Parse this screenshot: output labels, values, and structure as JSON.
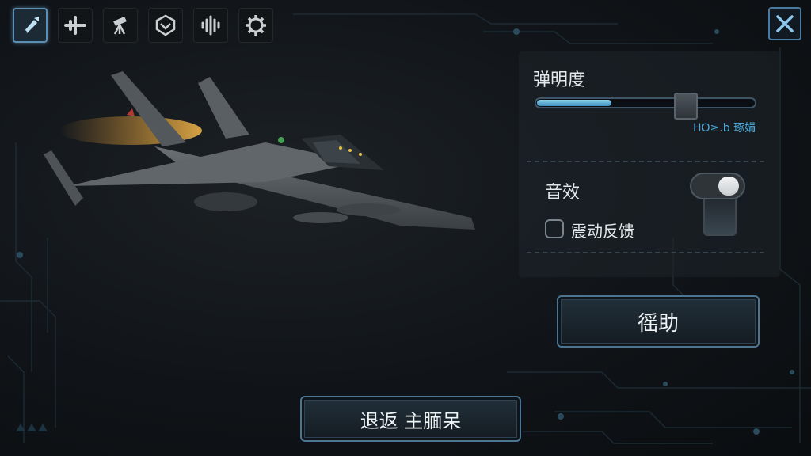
{
  "toolbar": {
    "items": [
      {
        "icon": "tools-icon",
        "active": true
      },
      {
        "icon": "plane-icon",
        "active": false
      },
      {
        "icon": "telescope-icon",
        "active": false
      },
      {
        "icon": "emblem-icon",
        "active": false
      },
      {
        "icon": "soundwave-icon",
        "active": false
      },
      {
        "icon": "cog-icon",
        "active": false
      }
    ]
  },
  "close": {
    "icon": "close-icon"
  },
  "settings": {
    "brightness": {
      "label": "弹明度",
      "value": 0.69,
      "fill": 0.34,
      "caption": "HO≥.b 琢娟"
    },
    "sound": {
      "label": "音效",
      "enabled": true
    },
    "vibration": {
      "label": "震动反馈",
      "checked": false
    }
  },
  "buttons": {
    "help": "徭助",
    "back": "退返 主腼呆"
  },
  "colors": {
    "accent": "#4aa8d8",
    "border": "#4c7592",
    "background": "#101418"
  }
}
